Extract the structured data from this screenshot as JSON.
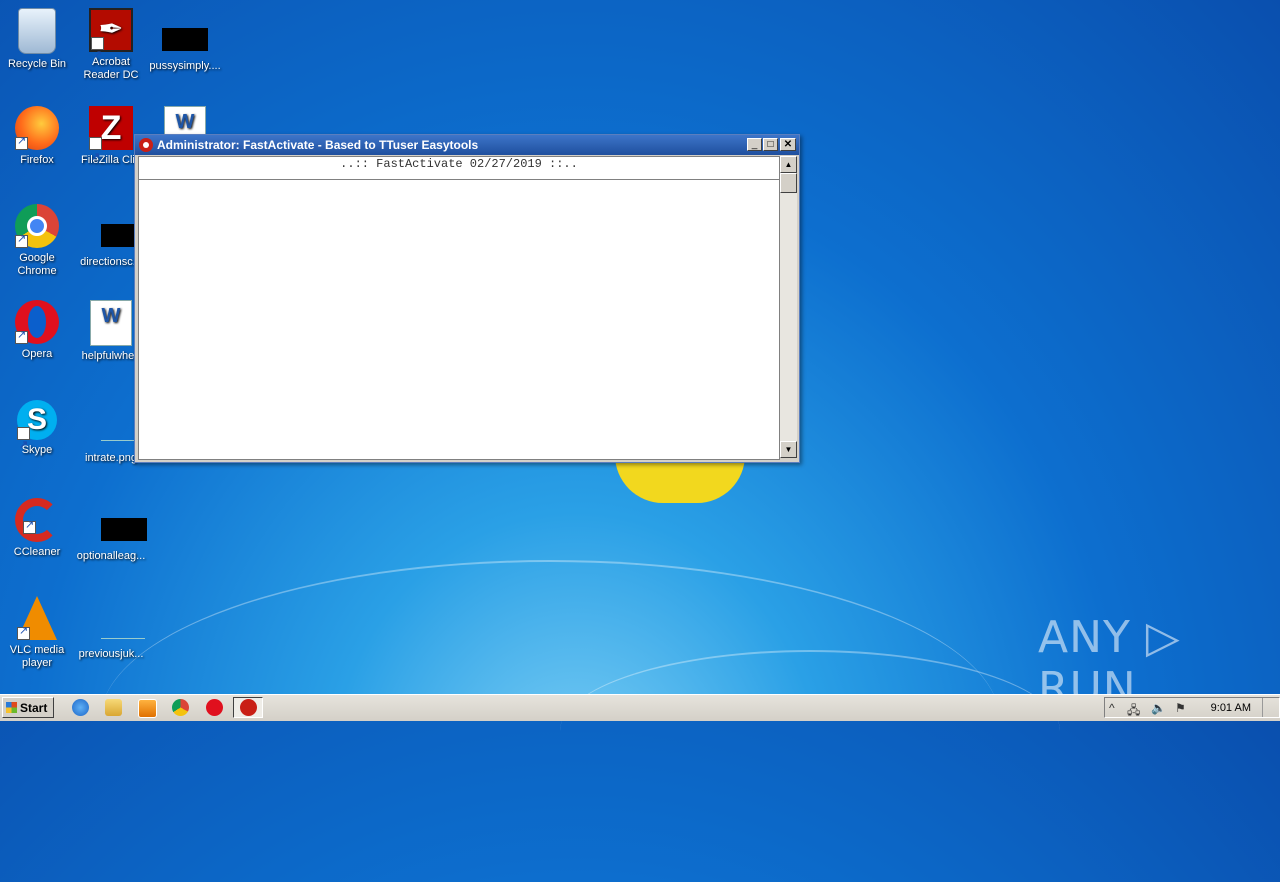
{
  "desktop": {
    "icons": [
      {
        "label": "Recycle Bin",
        "icon": "recycle-bin-icon"
      },
      {
        "label": "Acrobat\nReader DC",
        "icon": "acrobat-icon"
      },
      {
        "label": "pussysimply....",
        "icon": "file-thumbnail-icon"
      },
      {
        "label": "Firefox",
        "icon": "firefox-icon"
      },
      {
        "label": "FileZilla Clie",
        "icon": "filezilla-icon"
      },
      {
        "label": "",
        "icon": "word-doc-icon"
      },
      {
        "label": "Google\nChrome",
        "icon": "chrome-icon"
      },
      {
        "label": "directionsc...",
        "icon": "file-thumbnail-icon"
      },
      {
        "label": "Opera",
        "icon": "opera-icon"
      },
      {
        "label": "helpfulwhen",
        "icon": "word-doc-icon"
      },
      {
        "label": "Skype",
        "icon": "skype-icon"
      },
      {
        "label": "intrate.png",
        "icon": "png-file-icon"
      },
      {
        "label": "CCleaner",
        "icon": "ccleaner-icon"
      },
      {
        "label": "optionalleag...",
        "icon": "file-thumbnail-icon"
      },
      {
        "label": "VLC media\nplayer",
        "icon": "vlc-icon"
      },
      {
        "label": "previousjuk...",
        "icon": "file-thumbnail-icon"
      }
    ]
  },
  "window": {
    "title": "Administrator:  FastActivate - Based to TTuser Easytools",
    "banner": "..:: FastActivate 02/27/2019 ::..",
    "minimize": "_",
    "maximize": "□",
    "close": "✕"
  },
  "taskbar": {
    "start_label": "Start",
    "clock": "9:01 AM",
    "pinned": [
      "ie-icon",
      "explorer-icon",
      "media-player-icon",
      "chrome-icon",
      "opera-icon",
      "fastactivate-icon"
    ]
  },
  "watermark": "ANY ▷ RUN",
  "colors": {
    "titlebar": "#1f4f9e",
    "desktop": "#0d6fcf",
    "taskbar": "#d4d0c8"
  }
}
